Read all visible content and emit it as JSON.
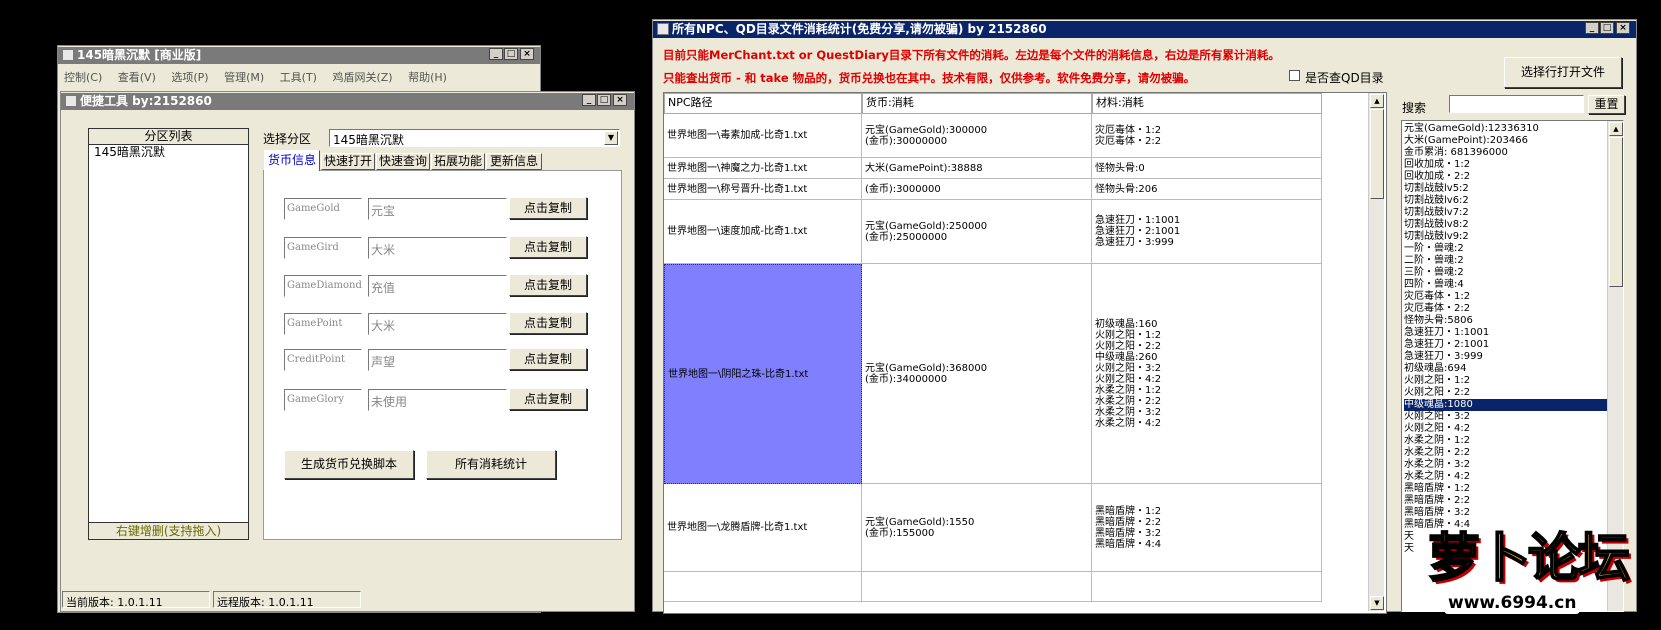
{
  "main_window": {
    "title": "145暗黑沉默 [商业版]",
    "menu": [
      "控制(C)",
      "查看(V)",
      "选项(P)",
      "管理(M)",
      "工具(T)",
      "鸡盾网关(Z)",
      "帮助(H)"
    ]
  },
  "quick_tools": {
    "title": "便捷工具   by:2152860",
    "partition_list": {
      "header": "分区列表",
      "items": [
        "145暗黑沉默"
      ],
      "footer": "右键增删(支持拖入)"
    },
    "select_label": "选择分区",
    "select_value": "145暗黑沉默",
    "tabs": [
      "货币信息",
      "快速打开",
      "快速查询",
      "拓展功能",
      "更新信息"
    ],
    "currency_rows": [
      {
        "code": "GameGold",
        "name": "元宝",
        "button": "点击复制"
      },
      {
        "code": "GameGird",
        "name": "大米",
        "button": "点击复制"
      },
      {
        "code": "GameDiamond",
        "name": "充值",
        "button": "点击复制"
      },
      {
        "code": "GamePoint",
        "name": "大米",
        "button": "点击复制"
      },
      {
        "code": "CreditPoint",
        "name": "声望",
        "button": "点击复制"
      },
      {
        "code": "GameGlory",
        "name": "未使用",
        "button": "点击复制"
      }
    ],
    "generate_button": "生成货币兑换脚本",
    "all_stats_button": "所有消耗统计",
    "status_current": "当前版本: 1.0.1.11",
    "status_remote": "远程版本: 1.0.1.11"
  },
  "stats_window": {
    "title": "所有NPC、QD目录文件消耗统计(免费分享,请勿被骗)      by 2152860",
    "info_line1": "目前只能MerChant.txt or QuestDiary目录下所有文件的消耗。左边是每个文件的消耗信息，右边是所有累计消耗。",
    "info_line2": "只能查出货币 - 和 take 物品的，货币兑换也在其中。技术有限，仅供参考。软件免费分享，请勿被骗。",
    "checkbox_label": "是否查QD目录",
    "open_button": "选择行打开文件",
    "table": {
      "headers": [
        "NPC路径",
        "货币:消耗",
        "材料:消耗"
      ],
      "rows": [
        {
          "path": "世界地图一\\毒素加成-比奇1.txt",
          "currency": [
            "元宝(GameGold):300000",
            "(金币):30000000"
          ],
          "materials": [
            "灾厄毒体・1:2",
            "灾厄毒体・2:2"
          ]
        },
        {
          "path": "世界地图一\\神魔之力-比奇1.txt",
          "currency": [
            "大米(GamePoint):38888"
          ],
          "materials": [
            "怪物头骨:0"
          ]
        },
        {
          "path": "世界地图一\\称号晋升-比奇1.txt",
          "currency": [
            "(金币):3000000"
          ],
          "materials": [
            "怪物头骨:206"
          ]
        },
        {
          "path": "世界地图一\\速度加成-比奇1.txt",
          "currency": [
            "元宝(GameGold):250000",
            "(金币):25000000"
          ],
          "materials": [
            "急速狂刀・1:1001",
            "急速狂刀・2:1001",
            "急速狂刀・3:999"
          ]
        },
        {
          "path": "世界地图一\\阴阳之珠-比奇1.txt",
          "currency": [
            "元宝(GameGold):368000",
            "(金币):34000000"
          ],
          "materials": [
            "初级魂晶:160",
            "火刚之阳・1:2",
            "火刚之阳・2:2",
            "中级魂晶:260",
            "火刚之阳・3:2",
            "火刚之阳・4:2",
            "水柔之阴・1:2",
            "水柔之阴・2:2",
            "水柔之阴・3:2",
            "水柔之阴・4:2"
          ]
        },
        {
          "path": "世界地图一\\龙腾盾牌-比奇1.txt",
          "currency": [
            "元宝(GameGold):1550",
            "(金币):155000"
          ],
          "materials": [
            "黑暗盾牌・1:2",
            "黑暗盾牌・2:2",
            "黑暗盾牌・3:2",
            "黑暗盾牌・4:4"
          ]
        }
      ]
    },
    "search_label": "搜索",
    "reset_button": "重置",
    "summary_list": [
      "元宝(GameGold):12336310",
      "大米(GamePoint):203466",
      "金币累消: 681396000",
      "回收加成・1:2",
      "回收加成・2:2",
      "切割战鼓lv5:2",
      "切割战鼓lv6:2",
      "切割战鼓lv7:2",
      "切割战鼓lv8:2",
      "切割战鼓lv9:2",
      "一阶・兽魂:2",
      "二阶・兽魂:2",
      "三阶・兽魂:2",
      "四阶・兽魂:4",
      "灾厄毒体・1:2",
      "灾厄毒体・2:2",
      "怪物头骨:5806",
      "急速狂刀・1:1001",
      "急速狂刀・2:1001",
      "急速狂刀・3:999",
      "初级魂晶:694",
      "火刚之阳・1:2",
      "火刚之阳・2:2",
      "中级魂晶:1080",
      "火刚之阳・3:2",
      "火刚之阳・4:2",
      "水柔之阴・1:2",
      "水柔之阴・2:2",
      "水柔之阴・3:2",
      "水柔之阴・4:2",
      "黑暗盾牌・1:2",
      "黑暗盾牌・2:2",
      "黑暗盾牌・3:2",
      "黑暗盾牌・4:4",
      "天",
      "天"
    ],
    "summary_selected_index": 23
  },
  "watermark": {
    "text": "萝卜论坛",
    "url": "www.6994.cn"
  }
}
